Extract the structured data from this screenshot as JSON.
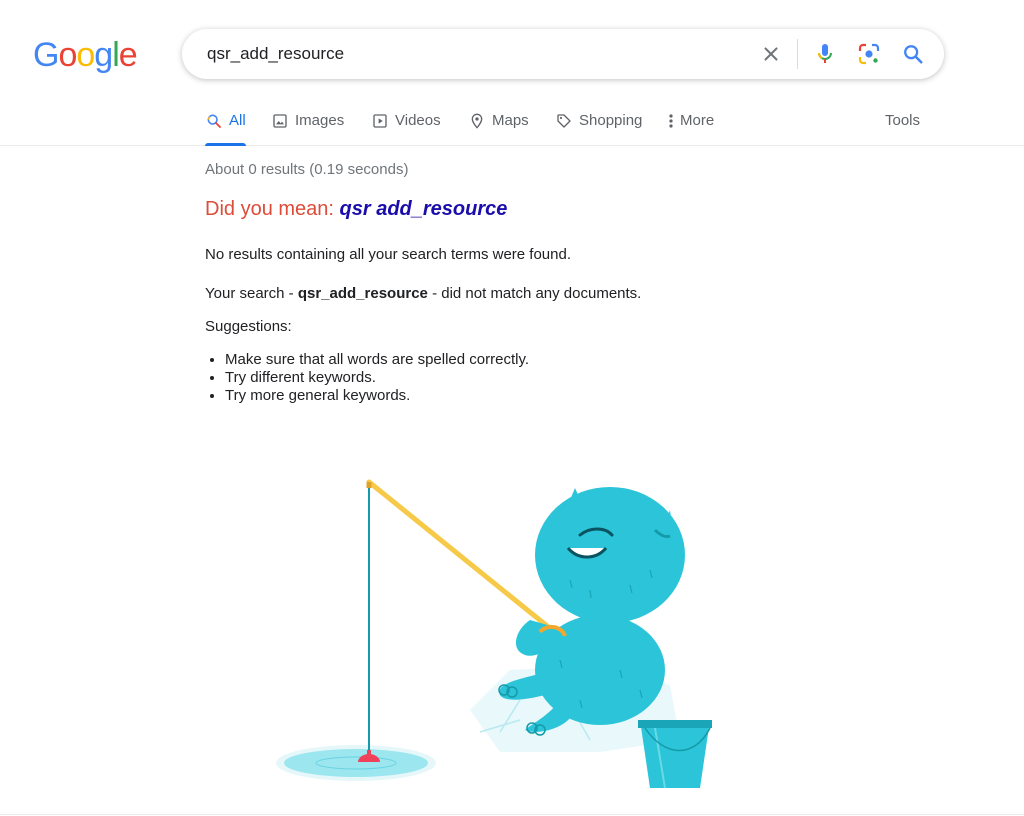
{
  "logo": {
    "letters": [
      "G",
      "o",
      "o",
      "g",
      "l",
      "e"
    ],
    "colors": [
      "#4285F4",
      "#EA4335",
      "#FBBC05",
      "#4285F4",
      "#34A853",
      "#EA4335"
    ]
  },
  "search": {
    "value": "qsr_add_resource"
  },
  "icons": {
    "clear": "close-icon",
    "voice": "microphone-icon",
    "lens": "camera-lens-icon",
    "search": "search-icon"
  },
  "tabs": [
    {
      "label": "All",
      "icon": "search-icon",
      "active": true
    },
    {
      "label": "Images",
      "icon": "image-icon"
    },
    {
      "label": "Videos",
      "icon": "play-icon"
    },
    {
      "label": "Maps",
      "icon": "map-pin-icon"
    },
    {
      "label": "Shopping",
      "icon": "tag-icon"
    },
    {
      "label": "More",
      "icon": "more-vert-icon"
    }
  ],
  "tools_label": "Tools",
  "results": {
    "stats": "About 0 results (0.19 seconds)",
    "did_you_mean_prefix": "Did you mean: ",
    "did_you_mean_query": "qsr add_resource",
    "no_results": "No results containing all your search terms were found.",
    "your_search_prefix": "Your search - ",
    "your_search_term": "qsr_add_resource",
    "your_search_suffix": " - did not match any documents.",
    "suggestions_title": "Suggestions:",
    "suggestions": [
      "Make sure that all words are spelled correctly.",
      "Try different keywords.",
      "Try more general keywords."
    ]
  },
  "colors": {
    "accent": "#1a73e8",
    "link": "#1a0dab",
    "dym": "#dd4b39",
    "monster": "#2bc4d8"
  }
}
